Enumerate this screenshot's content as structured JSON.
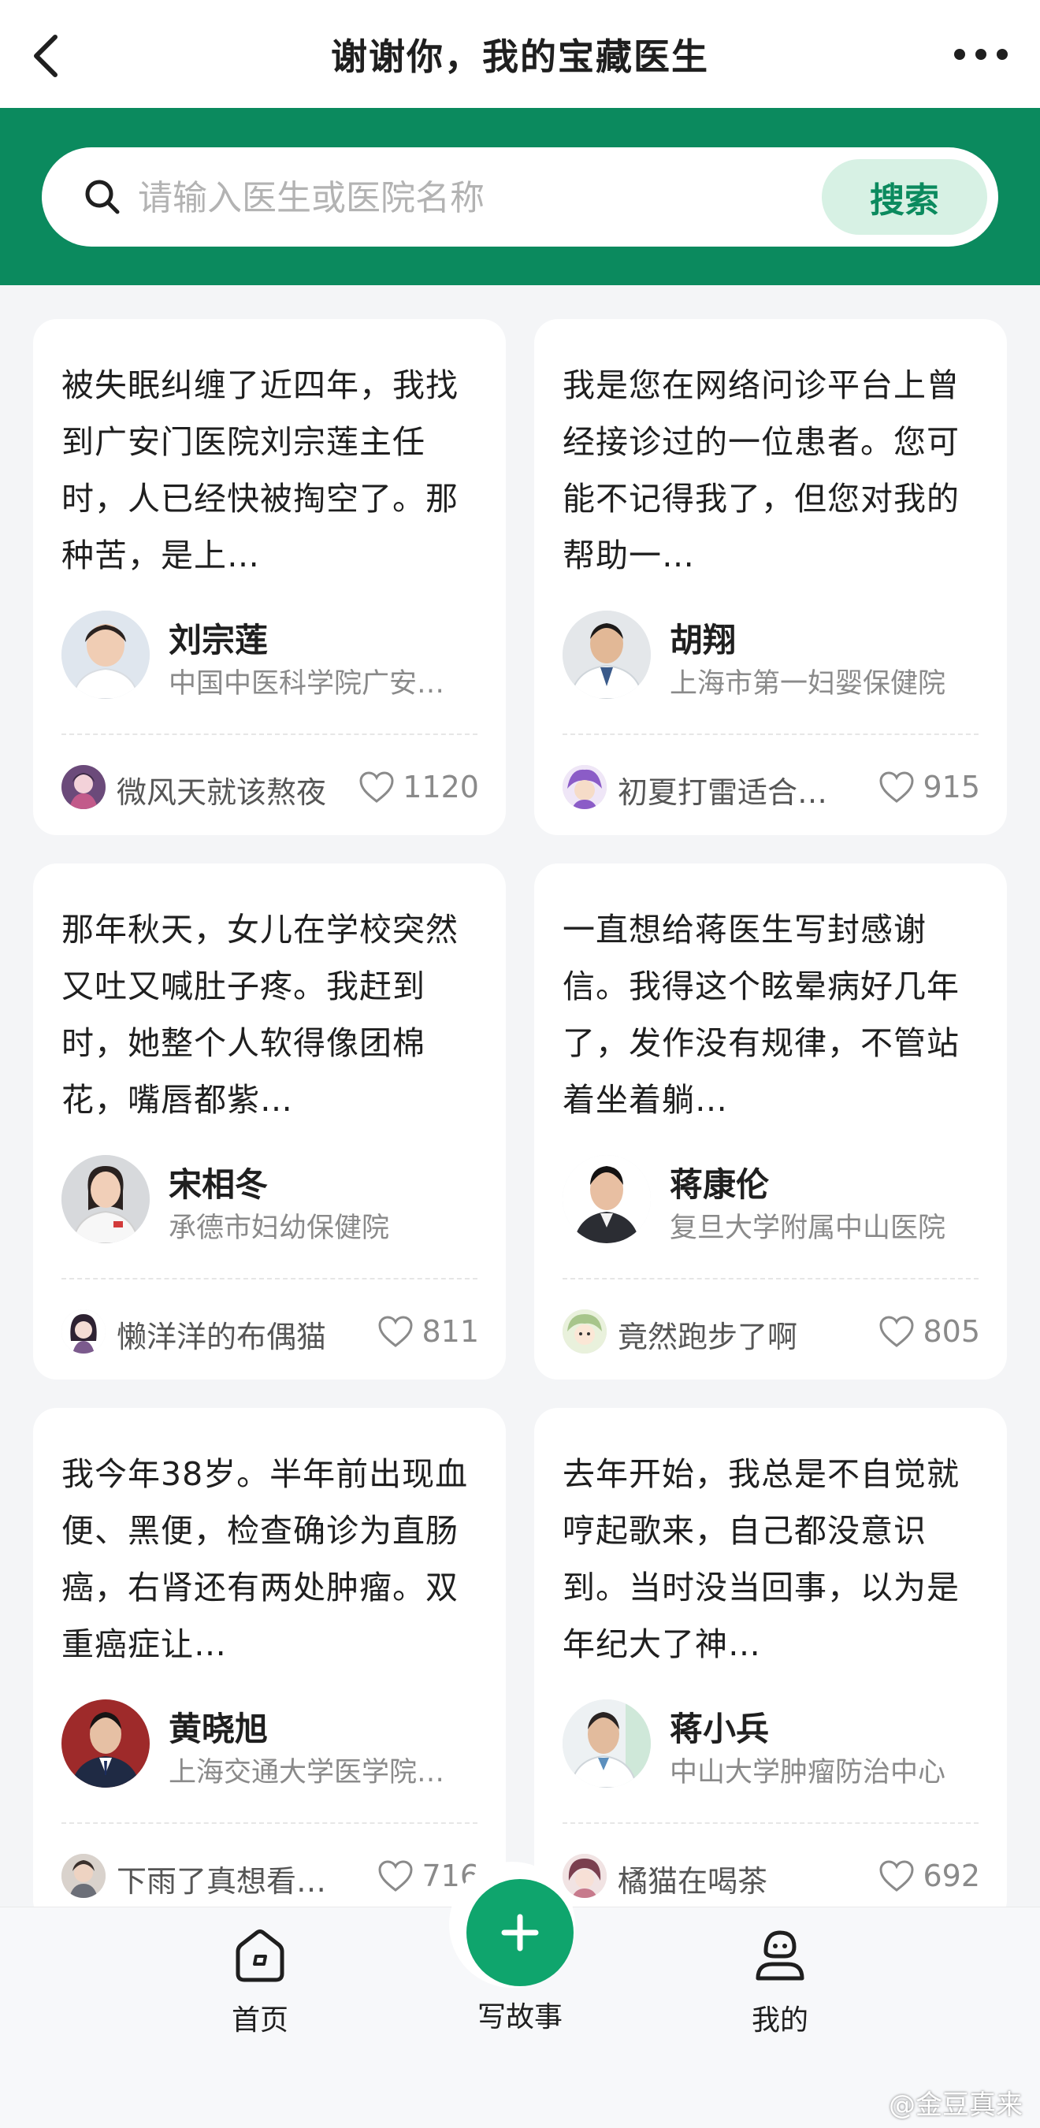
{
  "header": {
    "title": "谢谢你，我的宝藏医生",
    "back_icon": "chevron-left-icon",
    "more_icon": "more-dots-icon"
  },
  "search": {
    "placeholder": "请输入医生或医院名称",
    "value": "",
    "button_label": "搜索"
  },
  "colors": {
    "brand_green": "#0b8a5e",
    "fab_green": "#0fa56d",
    "search_button_bg": "#d7f1e4"
  },
  "stories": [
    {
      "text": " 被失眠纠缠了近四年，我找到广安门医院刘宗莲主任时，人已经快被掏空了。那种苦，是上…",
      "doctor_name": "刘宗莲",
      "hospital": "中国中医科学院广安…",
      "user_name": "微风天就该熬夜",
      "likes": "1120"
    },
    {
      "text": "我是您在网络问诊平台上曾经接诊过的一位患者。您可能不记得我了，但您对我的帮助一…",
      "doctor_name": "胡翔",
      "hospital": "上海市第一妇婴保健院",
      "user_name": "初夏打雷适合…",
      "likes": "915"
    },
    {
      "text": "那年秋天，女儿在学校突然又吐又喊肚子疼。我赶到时，她整个人软得像团棉花，嘴唇都紫…",
      "doctor_name": "宋相冬",
      "hospital": "承德市妇幼保健院",
      "user_name": "懒洋洋的布偶猫",
      "likes": "811"
    },
    {
      "text": "一直想给蒋医生写封感谢信。我得这个眩晕病好几年了，发作没有规律，不管站着坐着躺…",
      "doctor_name": "蒋康伦",
      "hospital": "复旦大学附属中山医院",
      "user_name": "竟然跑步了啊",
      "likes": "805"
    },
    {
      "text": "我今年38岁。半年前出现血便、黑便，检查确诊为直肠癌，右肾还有两处肿瘤。双重癌症让…",
      "doctor_name": "黄晓旭",
      "hospital": "上海交通大学医学院…",
      "user_name": "下雨了真想看…",
      "likes": "716"
    },
    {
      "text": "去年开始，我总是不自觉就哼起歌来，自己都没意识到。当时没当回事，以为是年纪大了神…",
      "doctor_name": "蒋小兵",
      "hospital": "中山大学肿瘤防治中心",
      "user_name": "橘猫在喝茶",
      "likes": "692"
    }
  ],
  "tabbar": {
    "home_label": "首页",
    "write_label": "写故事",
    "mine_label": "我的",
    "home_icon": "home-icon",
    "write_icon": "plus-icon",
    "mine_icon": "profile-icon"
  },
  "watermark": "@金豆真来"
}
